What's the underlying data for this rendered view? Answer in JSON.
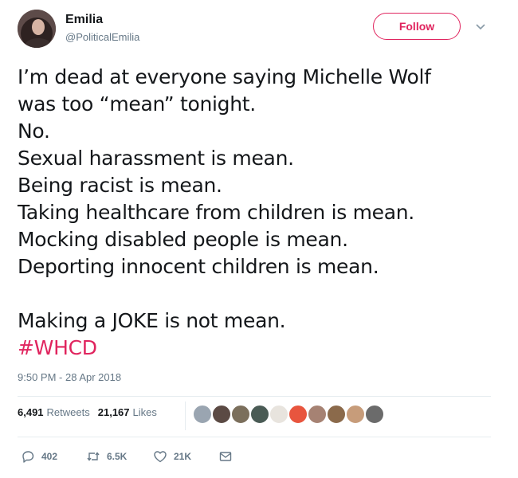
{
  "user": {
    "display_name": "Emilia",
    "handle": "@PoliticalEmilia",
    "follow_label": "Follow"
  },
  "tweet": {
    "lines": [
      "I’m dead at everyone saying Michelle Wolf",
      "was too “mean” tonight.",
      "No.",
      "Sexual harassment is mean.",
      "Being racist is mean.",
      "Taking healthcare from children is mean.",
      "Mocking disabled people is mean.",
      "Deporting innocent children is mean.",
      "Making a JOKE is not mean."
    ],
    "hashtag": "#WHCD",
    "timestamp": "9:50 PM - 28 Apr 2018"
  },
  "stats": {
    "retweets_count": "6,491",
    "retweets_label": "Retweets",
    "likes_count": "21,167",
    "likes_label": "Likes"
  },
  "actions": {
    "reply_count": "402",
    "retweet_count": "6.5K",
    "like_count": "21K"
  },
  "colors": {
    "accent": "#e0245e",
    "muted": "#657786",
    "text": "#14171a",
    "divider": "#e6ecf0"
  },
  "liker_avatars": [
    {
      "name": "liker-avatar",
      "color": "#9aa5b1"
    },
    {
      "name": "liker-avatar",
      "color": "#5b4a44"
    },
    {
      "name": "liker-avatar",
      "color": "#7b6f5c"
    },
    {
      "name": "liker-avatar",
      "color": "#4a5b55"
    },
    {
      "name": "liker-avatar",
      "color": "#e8e4de"
    },
    {
      "name": "liker-avatar",
      "color": "#e8553e"
    },
    {
      "name": "liker-avatar",
      "color": "#a68273"
    },
    {
      "name": "liker-avatar",
      "color": "#8b6a4b"
    },
    {
      "name": "liker-avatar",
      "color": "#c79c7a"
    },
    {
      "name": "liker-avatar",
      "color": "#6b6b6b"
    }
  ]
}
